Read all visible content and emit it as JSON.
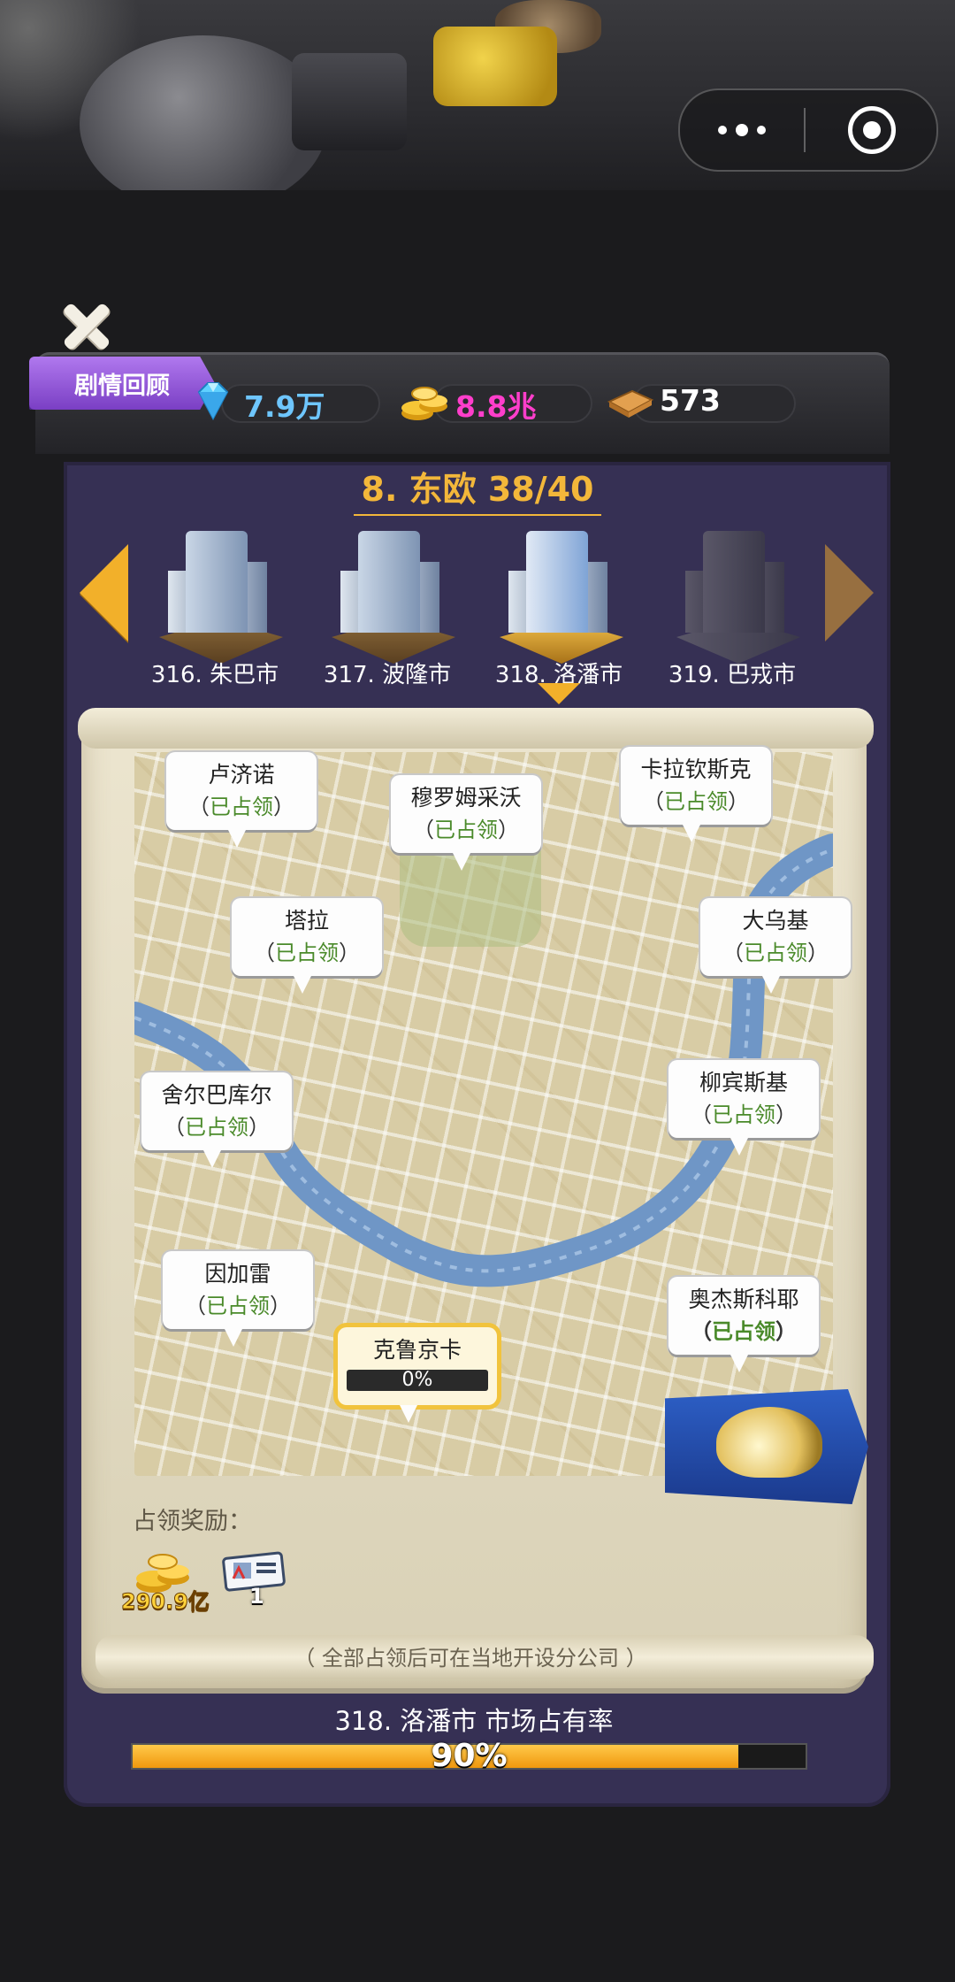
{
  "header": {
    "story_review_label": "剧情回顾",
    "resources": {
      "diamonds": "7.9万",
      "gold": "8.8兆",
      "books": "573"
    },
    "colors": {
      "diamonds": "#6ec6ff",
      "gold": "#ff3ecb",
      "books": "#ffffff"
    }
  },
  "region": {
    "title": "8. 东欧 38/40"
  },
  "cities": [
    {
      "label": "316. 朱巴市",
      "state": "unlocked"
    },
    {
      "label": "317. 波隆市",
      "state": "unlocked"
    },
    {
      "label": "318. 洛潘市",
      "state": "selected"
    },
    {
      "label": "319. 巴戎市",
      "state": "locked"
    }
  ],
  "map": {
    "pins": [
      {
        "name": "卢济诺",
        "status": "已占领",
        "open": "（",
        "close": "）"
      },
      {
        "name": "穆罗姆采沃",
        "status": "已占领",
        "open": "（",
        "close": "）"
      },
      {
        "name": "卡拉钦斯克",
        "status": "已占领",
        "open": "（",
        "close": "）"
      },
      {
        "name": "塔拉",
        "status": "已占领",
        "open": "（",
        "close": "）"
      },
      {
        "name": "大乌基",
        "status": "已占领",
        "open": "（",
        "close": "）"
      },
      {
        "name": "舍尔巴库尔",
        "status": "已占领",
        "open": "（",
        "close": "）"
      },
      {
        "name": "柳宾斯基",
        "status": "已占领",
        "open": "（",
        "close": "）"
      },
      {
        "name": "因加雷",
        "status": "已占领",
        "open": "（",
        "close": "）"
      },
      {
        "name": "奥杰斯科耶",
        "status": "已占领",
        "open": "（",
        "close": "）"
      },
      {
        "name": "克鲁京卡",
        "progress_text": "0%",
        "progress": 0
      }
    ]
  },
  "rewards": {
    "title": "占领奖励：",
    "gold_amount": "290.9亿",
    "doc_count": "1"
  },
  "branch_note": "（ 全部占领后可在当地开设分公司 ）",
  "market_share": {
    "label": "318. 洛潘市 市场占有率",
    "value_text": "90%",
    "value": 0.9
  }
}
